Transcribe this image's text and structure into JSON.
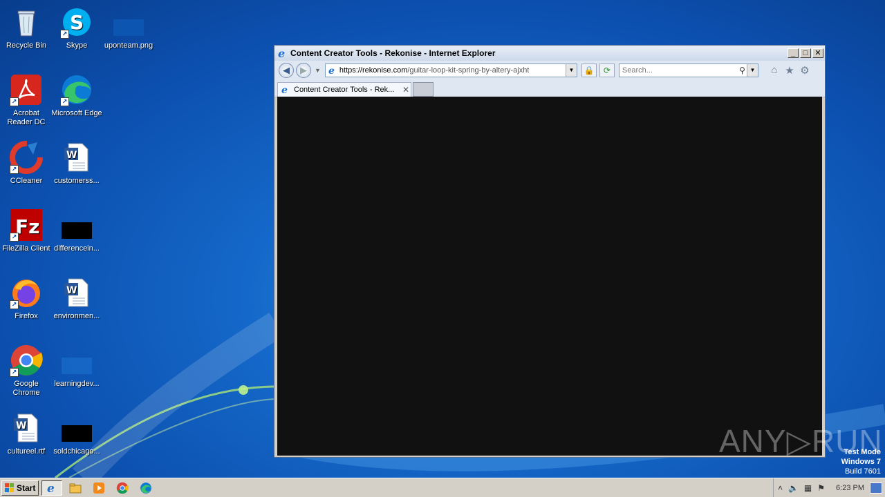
{
  "desktop": {
    "icons": [
      {
        "label": "Recycle Bin",
        "icon": "recycle-bin-icon"
      },
      {
        "label": "Skype",
        "icon": "skype-icon"
      },
      {
        "label": "uponteam.png",
        "icon": "image-file-icon"
      },
      {
        "label": "Acrobat Reader DC",
        "icon": "acrobat-icon"
      },
      {
        "label": "Microsoft Edge",
        "icon": "edge-icon"
      },
      {
        "label": "CCleaner",
        "icon": "ccleaner-icon"
      },
      {
        "label": "customerss...",
        "icon": "word-doc-icon"
      },
      {
        "label": "FileZilla Client",
        "icon": "filezilla-icon"
      },
      {
        "label": "differencein...",
        "icon": "black-file-icon"
      },
      {
        "label": "Firefox",
        "icon": "firefox-icon"
      },
      {
        "label": "environmen...",
        "icon": "word-doc-icon"
      },
      {
        "label": "Google Chrome",
        "icon": "chrome-icon"
      },
      {
        "label": "learningdev...",
        "icon": "blank-file-icon"
      },
      {
        "label": "cultureel.rtf",
        "icon": "word-doc-icon"
      },
      {
        "label": "soldchicago...",
        "icon": "black-file-icon"
      }
    ]
  },
  "browser": {
    "title": "Content Creator Tools - Rekonise - Internet Explorer",
    "url_host": "https://rekonise.com",
    "url_path": "/guitar-loop-kit-spring-by-altery-ajxht",
    "search_placeholder": "Search...",
    "tab_label": "Content Creator Tools - Rek...",
    "buttons": {
      "minimize": "_",
      "maximize": "□",
      "close": "✕",
      "back": "◀",
      "forward": "▶",
      "tab_close": "✕"
    }
  },
  "watermark": {
    "brand": "ANY▷RUN",
    "line1": "Test Mode",
    "line2": "Windows 7",
    "line3": "Build 7601"
  },
  "taskbar": {
    "start_label": "Start",
    "clock": "6:23 PM"
  }
}
